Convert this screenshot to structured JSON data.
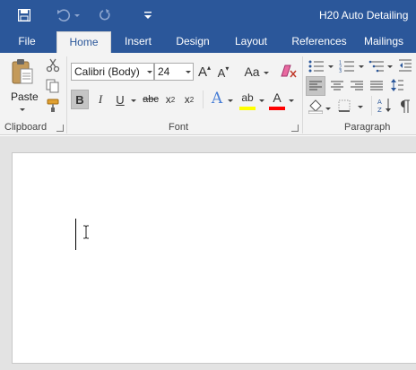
{
  "window": {
    "title": "H20 Auto Detailing"
  },
  "quick_access": [
    "save-icon",
    "undo-icon",
    "redo-icon",
    "customize-qat-icon"
  ],
  "tabs": [
    {
      "label": "File"
    },
    {
      "label": "Home",
      "active": true
    },
    {
      "label": "Insert"
    },
    {
      "label": "Design"
    },
    {
      "label": "Layout"
    },
    {
      "label": "References"
    },
    {
      "label": "Mailings"
    }
  ],
  "clipboard": {
    "paste_label": "Paste",
    "group_label": "Clipboard"
  },
  "font": {
    "name": "Calibri (Body)",
    "size": "24",
    "case_label": "Aa",
    "bold": "B",
    "italic": "I",
    "underline": "U",
    "strike": "abc",
    "subscript": "x",
    "sub_mark": "2",
    "superscript": "x",
    "sup_mark": "2",
    "grow": "A",
    "shrink": "A",
    "effects": "A",
    "highlight": "ab",
    "font_color": "A",
    "group_label": "Font"
  },
  "paragraph": {
    "group_label": "Paragraph"
  },
  "colors": {
    "brand": "#2b579a",
    "ribbon": "#f3f3f3",
    "highlight": "#ffff00",
    "font_color": "#ff0000",
    "effects": "#4a7fd6"
  }
}
